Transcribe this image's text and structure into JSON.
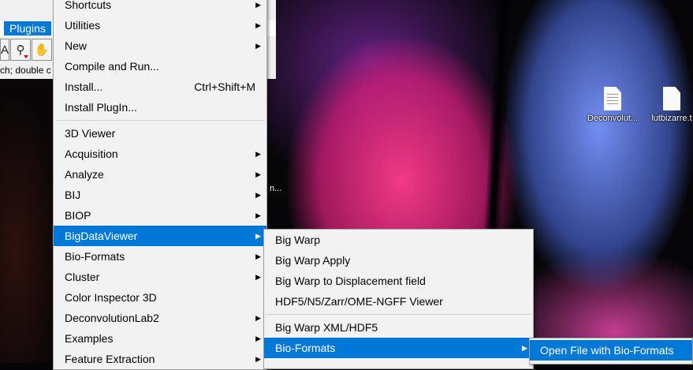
{
  "imagej": {
    "menubar_item": "Plugins",
    "status_text": "ch; double c",
    "tools": [
      {
        "icon": "text-tool-icon",
        "glyph": "A"
      },
      {
        "icon": "magnifier-icon",
        "glyph": "⚲"
      },
      {
        "icon": "hand-icon",
        "glyph": "✋"
      }
    ]
  },
  "desktop": {
    "icons": [
      {
        "label": "Deconvolut...",
        "icon": "document-icon"
      },
      {
        "label": "lutbizarre.t",
        "icon": "blank-file-icon"
      }
    ],
    "fragment_text": "n..."
  },
  "plugins_menu": {
    "items": [
      {
        "label": "Shortcuts",
        "submenu": true
      },
      {
        "label": "Utilities",
        "submenu": true
      },
      {
        "label": "New",
        "submenu": true
      },
      {
        "label": "Compile and Run...",
        "submenu": false
      },
      {
        "label": "Install...",
        "accel": "Ctrl+Shift+M",
        "submenu": false
      },
      {
        "label": "Install PlugIn...",
        "submenu": false
      },
      {
        "separator": true
      },
      {
        "label": "3D Viewer",
        "submenu": false
      },
      {
        "label": "Acquisition",
        "submenu": true
      },
      {
        "label": "Analyze",
        "submenu": true
      },
      {
        "label": "BIJ",
        "submenu": true
      },
      {
        "label": "BIOP",
        "submenu": true
      },
      {
        "label": "BigDataViewer",
        "submenu": true,
        "highlighted": true
      },
      {
        "label": "Bio-Formats",
        "submenu": true
      },
      {
        "label": "Cluster",
        "submenu": true
      },
      {
        "label": "Color Inspector 3D",
        "submenu": false
      },
      {
        "label": "DeconvolutionLab2",
        "submenu": true
      },
      {
        "label": "Examples",
        "submenu": true
      },
      {
        "label": "Feature Extraction",
        "submenu": true
      }
    ]
  },
  "bigdataviewer_menu": {
    "items": [
      {
        "label": "Big Warp",
        "submenu": false
      },
      {
        "label": "Big Warp Apply",
        "submenu": false
      },
      {
        "label": "Big Warp to Displacement field",
        "submenu": false
      },
      {
        "label": "HDF5/N5/Zarr/OME-NGFF Viewer",
        "submenu": false
      },
      {
        "separator": true
      },
      {
        "label": "Big Warp XML/HDF5",
        "submenu": false
      },
      {
        "label": "Bio-Formats",
        "submenu": true,
        "highlighted": true
      }
    ]
  },
  "bioformats_menu": {
    "items": [
      {
        "label": "Open File with Bio-Formats",
        "highlighted": true
      }
    ]
  },
  "colors": {
    "highlight": "#0078d7",
    "menu_bg": "#f2f2f2"
  }
}
